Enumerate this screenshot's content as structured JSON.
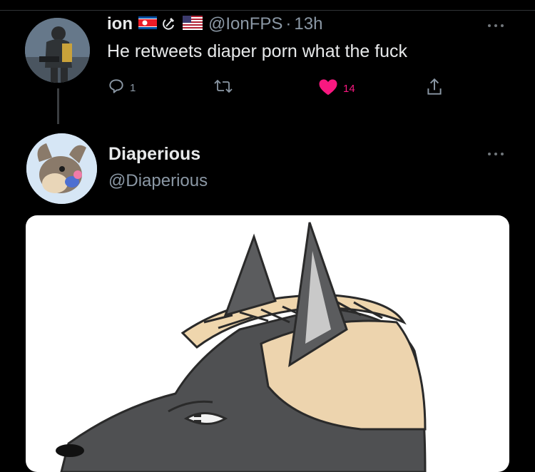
{
  "reply_tweet": {
    "name": "ion",
    "flags": [
      "north-korea-flag-icon",
      "hammer-sickle-icon",
      "usa-flag-icon"
    ],
    "handle": "@IonFPS",
    "separator": "·",
    "time": "13h",
    "text": "He retweets diaper porn what the fuck",
    "actions": {
      "reply_count": "1",
      "retweet_count": "",
      "like_count": "14",
      "liked": true
    },
    "avatar_icon": "soldier-avatar"
  },
  "quoted_user": {
    "name": "Diaperious",
    "handle": "@Diaperious",
    "avatar_icon": "furry-pacifier-avatar"
  },
  "media": {
    "icon": "wolf-drawing-image"
  },
  "colors": {
    "background": "#000000",
    "primary_text": "#e7e9ea",
    "secondary_text": "#8b98a5",
    "like": "#f91880"
  }
}
